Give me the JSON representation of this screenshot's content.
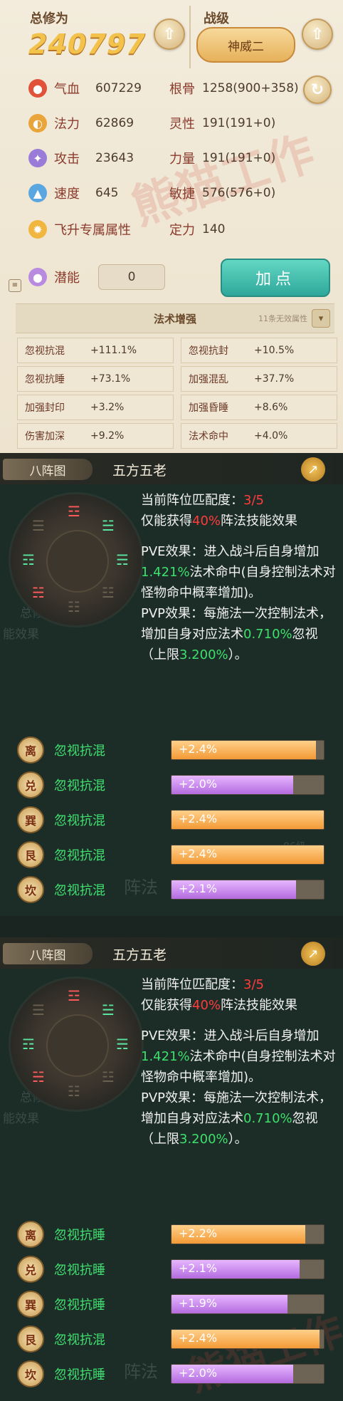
{
  "stats_panel": {
    "total_label": "总修为",
    "total_value": "240797",
    "rank_label": "战级",
    "rank_badge": "神威二",
    "stats": [
      {
        "name": "气血",
        "value": "607229",
        "name2": "根骨",
        "value2": "1258(900+358)"
      },
      {
        "name": "法力",
        "value": "62869",
        "name2": "灵性",
        "value2": "191(191+0)"
      },
      {
        "name": "攻击",
        "value": "23643",
        "name2": "力量",
        "value2": "191(191+0)"
      },
      {
        "name": "速度",
        "value": "645",
        "name2": "敏捷",
        "value2": "576(576+0)"
      }
    ],
    "ascend_label": "飞升专属属性",
    "focus_label": "定力",
    "focus_value": "140",
    "potential_label": "潜能",
    "potential_value": "0",
    "add_points_label": "加点",
    "section_title": "法术增强",
    "section_note": "11条无效属性",
    "enhancements": [
      {
        "name": "忽视抗混",
        "value": "+111.1%"
      },
      {
        "name": "忽视抗封",
        "value": "+10.5%"
      },
      {
        "name": "忽视抗睡",
        "value": "+73.1%"
      },
      {
        "name": "加强混乱",
        "value": "+37.7%"
      },
      {
        "name": "加强封印",
        "value": "+3.2%"
      },
      {
        "name": "加强昏睡",
        "value": "+8.6%"
      },
      {
        "name": "伤害加深",
        "value": "+9.2%"
      },
      {
        "name": "法术命中",
        "value": "+4.0%"
      }
    ],
    "watermark": "熊猫工作"
  },
  "cards": [
    {
      "tab": "八阵图",
      "title": "五方五老",
      "match_prefix": "当前阵位匹配度：",
      "match_value": "3/5",
      "effect_prefix": "仅能获得",
      "effect_percent": "40%",
      "effect_suffix": "阵法技能效果",
      "pve_prefix": "PVE效果：进入战斗后自身增加",
      "pve_value": "1.421%",
      "pve_suffix": "法术命中(自身控制法术对怪物命中概率增加)。",
      "pvp_prefix": "PVP效果：每施法一次控制法术，增加自身对应法术",
      "pvp_value": "0.710%",
      "pvp_mid": "忽视（上限",
      "pvp_cap": "3.200%",
      "pvp_suffix": "）。",
      "buffs": [
        {
          "trigram": "离",
          "name": "忽视抗混",
          "label": "+2.4%",
          "color": "orange",
          "fill": 0.95
        },
        {
          "trigram": "兑",
          "name": "忽视抗混",
          "label": "+2.0%",
          "color": "purple",
          "fill": 0.8
        },
        {
          "trigram": "巽",
          "name": "忽视抗混",
          "label": "+2.4%",
          "color": "orange",
          "fill": 1.0
        },
        {
          "trigram": "艮",
          "name": "忽视抗混",
          "label": "+2.4%",
          "color": "orange",
          "fill": 1.0
        },
        {
          "trigram": "坎",
          "name": "忽视抗混",
          "label": "+2.1%",
          "color": "purple",
          "fill": 0.82
        }
      ]
    },
    {
      "tab": "八阵图",
      "title": "五方五老",
      "match_prefix": "当前阵位匹配度：",
      "match_value": "3/5",
      "effect_prefix": "仅能获得",
      "effect_percent": "40%",
      "effect_suffix": "阵法技能效果",
      "pve_prefix": "PVE效果：进入战斗后自身增加",
      "pve_value": "1.421%",
      "pve_suffix": "法术命中(自身控制法术对怪物命中概率增加)。",
      "pvp_prefix": "PVP效果：每施法一次控制法术，增加自身对应法术",
      "pvp_value": "0.710%",
      "pvp_mid": "忽视（上限",
      "pvp_cap": "3.200%",
      "pvp_suffix": "）。",
      "buffs": [
        {
          "trigram": "离",
          "name": "忽视抗睡",
          "label": "+2.2%",
          "color": "orange",
          "fill": 0.88
        },
        {
          "trigram": "兑",
          "name": "忽视抗睡",
          "label": "+2.1%",
          "color": "purple",
          "fill": 0.84
        },
        {
          "trigram": "巽",
          "name": "忽视抗睡",
          "label": "+1.9%",
          "color": "purple",
          "fill": 0.76
        },
        {
          "trigram": "艮",
          "name": "忽视抗混",
          "label": "+2.4%",
          "color": "orange",
          "fill": 0.97
        },
        {
          "trigram": "坎",
          "name": "忽视抗睡",
          "label": "+2.0%",
          "color": "purple",
          "fill": 0.8
        }
      ]
    }
  ],
  "ghost_text": {
    "exp_label": "总修为",
    "effect_label": "能效果",
    "formation_label": "阵法",
    "level_label": "86级"
  },
  "colors": {
    "orange_bar": "#f39a36",
    "purple_bar": "#b46bdf",
    "green_text": "#3ee06b",
    "red_text": "#ff3b3b"
  }
}
